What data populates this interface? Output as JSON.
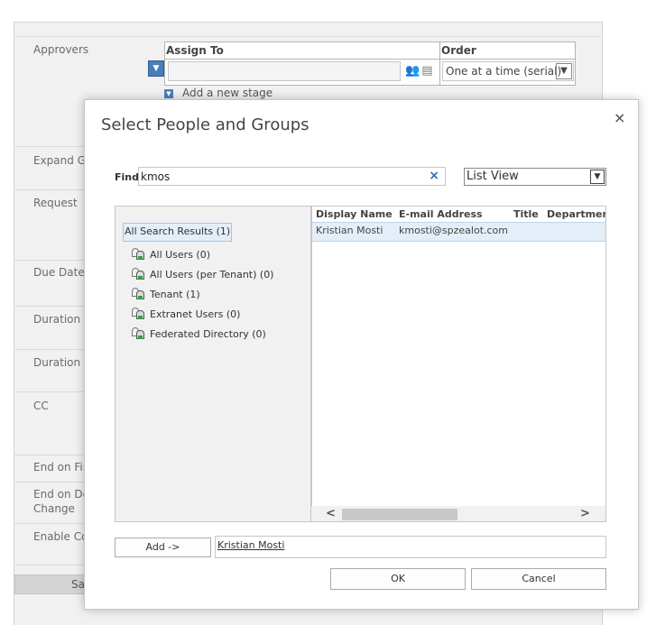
{
  "form": {
    "fields": [
      {
        "label": "Approvers"
      },
      {
        "label": "Expand Gr"
      },
      {
        "label": "Request"
      },
      {
        "label": "Due Date f"
      },
      {
        "label": "Duration F"
      },
      {
        "label": "Duration U"
      },
      {
        "label": "CC"
      },
      {
        "label": "End on Fir"
      },
      {
        "label": "End on Do"
      },
      {
        "label": "Change"
      },
      {
        "label": "Enable Co"
      }
    ],
    "save_label": "Sa",
    "approvers_table": {
      "assign_to_header": "Assign To",
      "order_header": "Order",
      "assign_to_value": "",
      "order_value": "One at a time (serial)",
      "add_stage": "Add a new stage"
    }
  },
  "dialog": {
    "title": "Select People and Groups",
    "close": "×",
    "find_label": "Find",
    "find_value": "kmos",
    "clear": "×",
    "view_value": "List View",
    "tree": {
      "root": "All Search Results (1)",
      "items": [
        "All Users (0)",
        "All Users (per Tenant) (0)",
        "Tenant (1)",
        "Extranet Users (0)",
        "Federated Directory (0)"
      ]
    },
    "results": {
      "columns": [
        "Display Name",
        "E-mail Address",
        "Title",
        "Departmen"
      ],
      "rows": [
        {
          "display_name": "Kristian Mosti",
          "email": "kmosti@spzealot.com",
          "title": "",
          "department": ""
        }
      ]
    },
    "add_button": "Add ->",
    "added_value": "Kristian Mosti",
    "ok": "OK",
    "cancel": "Cancel"
  },
  "icons": {
    "blue_arrow": "chevron-down-icon",
    "people_picker": "check-names-icon",
    "address_book": "address-book-icon",
    "group": "group-icon"
  }
}
